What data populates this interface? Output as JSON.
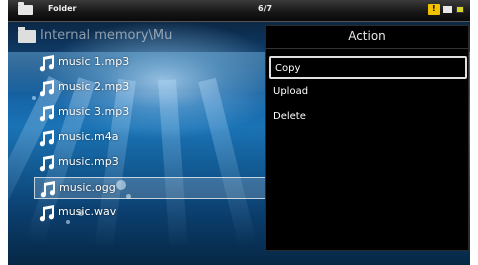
{
  "topbar": {
    "title": "Folder",
    "counter": "6/7"
  },
  "path": {
    "label": "Internal memory\\Mu"
  },
  "files": [
    {
      "name": "music 1.mp3"
    },
    {
      "name": "music 2.mp3"
    },
    {
      "name": "music 3.mp3"
    },
    {
      "name": "music.m4a"
    },
    {
      "name": "music.mp3"
    },
    {
      "name": "music.ogg",
      "selected": true
    },
    {
      "name": "music.wav"
    }
  ],
  "action_menu": {
    "title": "Action",
    "items": [
      {
        "label": "Copy",
        "selected": true
      },
      {
        "label": "Upload"
      },
      {
        "label": "Delete"
      }
    ]
  },
  "colors": {
    "topbar_bg": "#161616",
    "panel_bg": "#000000",
    "warning": "#f2c200"
  }
}
